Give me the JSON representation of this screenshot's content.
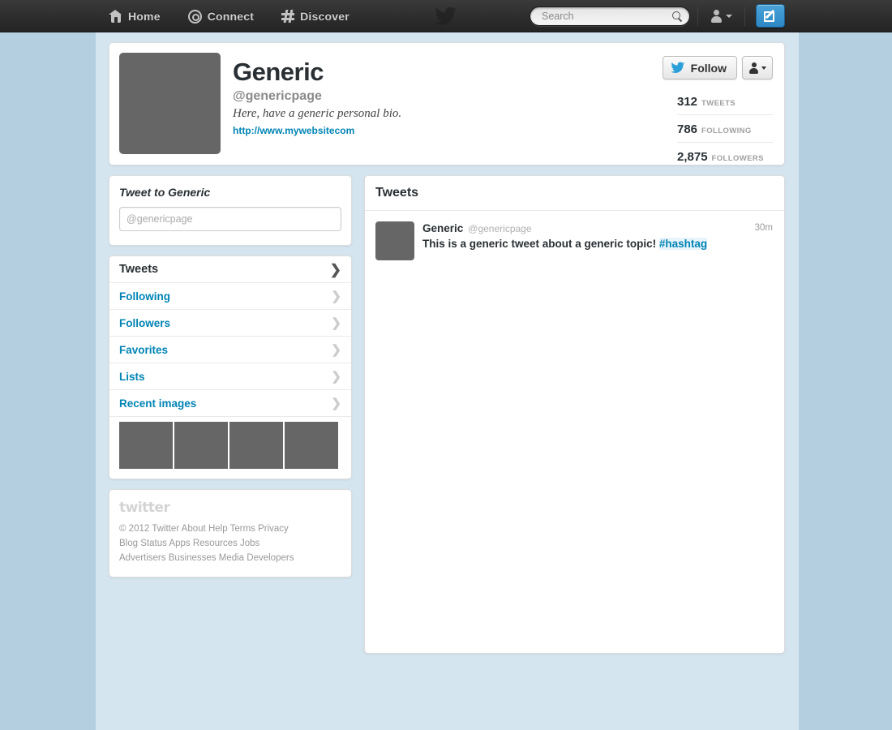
{
  "nav": {
    "items": [
      {
        "label": "Home",
        "icon": "home-icon"
      },
      {
        "label": "Connect",
        "icon": "at-icon"
      },
      {
        "label": "Discover",
        "icon": "hash-icon"
      }
    ],
    "search": {
      "placeholder": "Search",
      "value": ""
    },
    "logo_icon": "twitter-bird-icon",
    "compose_icon": "compose-icon",
    "account_icon": "person-icon"
  },
  "profile": {
    "name": "Generic",
    "handle": "@genericpage",
    "bio": "Here, have a generic personal bio.",
    "url": "http://www.mywebsitecom",
    "avatar": "profile-avatar-placeholder",
    "follow_label": "Follow",
    "follow_icon": "twitter-bird-icon",
    "more_icon": "person-caret-icon",
    "stats": [
      {
        "num": "312",
        "label": "TWEETS"
      },
      {
        "num": "786",
        "label": "FOLLOWING"
      },
      {
        "num": "2,875",
        "label": "FOLLOWERS"
      }
    ]
  },
  "tweetbox": {
    "title": "Tweet to Generic",
    "placeholder": "@genericpage",
    "value": ""
  },
  "navlist": [
    {
      "label": "Tweets",
      "active": true
    },
    {
      "label": "Following",
      "active": false
    },
    {
      "label": "Followers",
      "active": false
    },
    {
      "label": "Favorites",
      "active": false
    },
    {
      "label": "Lists",
      "active": false
    },
    {
      "label": "Recent images",
      "active": false
    }
  ],
  "thumbnails": [
    "thumb-1",
    "thumb-2",
    "thumb-3",
    "thumb-4"
  ],
  "footer": {
    "logo": "twitter",
    "line1": [
      "© 2012 Twitter",
      "About",
      "Help",
      "Terms",
      "Privacy"
    ],
    "line2": [
      "Blog",
      "Status",
      "Apps",
      "Resources",
      "Jobs"
    ],
    "line3": [
      "Advertisers",
      "Businesses",
      "Media",
      "Developers"
    ]
  },
  "timeline": {
    "heading": "Tweets",
    "tweets": [
      {
        "name": "Generic",
        "handle": "@genericpage",
        "time": "30m",
        "text_before": "This is a generic tweet about a generic topic! ",
        "hashtag": "#hashtag"
      }
    ]
  },
  "colors": {
    "link": "#0084b4",
    "page_bg": "#b3cfe0",
    "column_bg": "#d5e5ef",
    "nav_bg": "#2e2e2e",
    "placeholder_gray": "#666666"
  }
}
